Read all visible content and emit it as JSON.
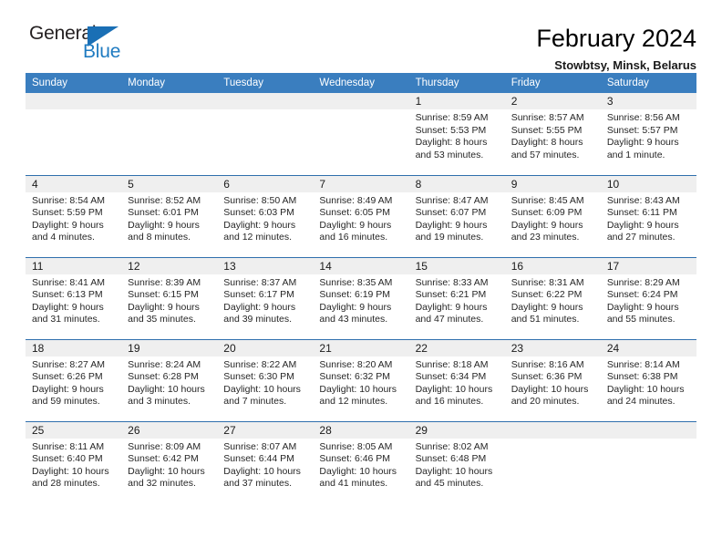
{
  "brand": {
    "name_top": "General",
    "name_bottom": "Blue",
    "accent_color": "#1a6fb5"
  },
  "header": {
    "title": "February 2024",
    "subtitle": "Stowbtsy, Minsk, Belarus"
  },
  "theme": {
    "header_row_bg": "#3a7ebf",
    "daynum_bg": "#efefef",
    "row_divider": "#2f6fad",
    "text": "#262626"
  },
  "labels": {
    "sunrise_prefix": "Sunrise:",
    "sunset_prefix": "Sunset:",
    "daylight_prefix": "Daylight:"
  },
  "weekdays": [
    "Sunday",
    "Monday",
    "Tuesday",
    "Wednesday",
    "Thursday",
    "Friday",
    "Saturday"
  ],
  "weeks": [
    [
      {
        "day": "",
        "empty": true
      },
      {
        "day": "",
        "empty": true
      },
      {
        "day": "",
        "empty": true
      },
      {
        "day": "",
        "empty": true
      },
      {
        "day": "1",
        "sunrise": "Sunrise: 8:59 AM",
        "sunset": "Sunset: 5:53 PM",
        "daylight_line1": "Daylight: 8 hours",
        "daylight_line2": "and 53 minutes."
      },
      {
        "day": "2",
        "sunrise": "Sunrise: 8:57 AM",
        "sunset": "Sunset: 5:55 PM",
        "daylight_line1": "Daylight: 8 hours",
        "daylight_line2": "and 57 minutes."
      },
      {
        "day": "3",
        "sunrise": "Sunrise: 8:56 AM",
        "sunset": "Sunset: 5:57 PM",
        "daylight_line1": "Daylight: 9 hours",
        "daylight_line2": "and 1 minute."
      }
    ],
    [
      {
        "day": "4",
        "sunrise": "Sunrise: 8:54 AM",
        "sunset": "Sunset: 5:59 PM",
        "daylight_line1": "Daylight: 9 hours",
        "daylight_line2": "and 4 minutes."
      },
      {
        "day": "5",
        "sunrise": "Sunrise: 8:52 AM",
        "sunset": "Sunset: 6:01 PM",
        "daylight_line1": "Daylight: 9 hours",
        "daylight_line2": "and 8 minutes."
      },
      {
        "day": "6",
        "sunrise": "Sunrise: 8:50 AM",
        "sunset": "Sunset: 6:03 PM",
        "daylight_line1": "Daylight: 9 hours",
        "daylight_line2": "and 12 minutes."
      },
      {
        "day": "7",
        "sunrise": "Sunrise: 8:49 AM",
        "sunset": "Sunset: 6:05 PM",
        "daylight_line1": "Daylight: 9 hours",
        "daylight_line2": "and 16 minutes."
      },
      {
        "day": "8",
        "sunrise": "Sunrise: 8:47 AM",
        "sunset": "Sunset: 6:07 PM",
        "daylight_line1": "Daylight: 9 hours",
        "daylight_line2": "and 19 minutes."
      },
      {
        "day": "9",
        "sunrise": "Sunrise: 8:45 AM",
        "sunset": "Sunset: 6:09 PM",
        "daylight_line1": "Daylight: 9 hours",
        "daylight_line2": "and 23 minutes."
      },
      {
        "day": "10",
        "sunrise": "Sunrise: 8:43 AM",
        "sunset": "Sunset: 6:11 PM",
        "daylight_line1": "Daylight: 9 hours",
        "daylight_line2": "and 27 minutes."
      }
    ],
    [
      {
        "day": "11",
        "sunrise": "Sunrise: 8:41 AM",
        "sunset": "Sunset: 6:13 PM",
        "daylight_line1": "Daylight: 9 hours",
        "daylight_line2": "and 31 minutes."
      },
      {
        "day": "12",
        "sunrise": "Sunrise: 8:39 AM",
        "sunset": "Sunset: 6:15 PM",
        "daylight_line1": "Daylight: 9 hours",
        "daylight_line2": "and 35 minutes."
      },
      {
        "day": "13",
        "sunrise": "Sunrise: 8:37 AM",
        "sunset": "Sunset: 6:17 PM",
        "daylight_line1": "Daylight: 9 hours",
        "daylight_line2": "and 39 minutes."
      },
      {
        "day": "14",
        "sunrise": "Sunrise: 8:35 AM",
        "sunset": "Sunset: 6:19 PM",
        "daylight_line1": "Daylight: 9 hours",
        "daylight_line2": "and 43 minutes."
      },
      {
        "day": "15",
        "sunrise": "Sunrise: 8:33 AM",
        "sunset": "Sunset: 6:21 PM",
        "daylight_line1": "Daylight: 9 hours",
        "daylight_line2": "and 47 minutes."
      },
      {
        "day": "16",
        "sunrise": "Sunrise: 8:31 AM",
        "sunset": "Sunset: 6:22 PM",
        "daylight_line1": "Daylight: 9 hours",
        "daylight_line2": "and 51 minutes."
      },
      {
        "day": "17",
        "sunrise": "Sunrise: 8:29 AM",
        "sunset": "Sunset: 6:24 PM",
        "daylight_line1": "Daylight: 9 hours",
        "daylight_line2": "and 55 minutes."
      }
    ],
    [
      {
        "day": "18",
        "sunrise": "Sunrise: 8:27 AM",
        "sunset": "Sunset: 6:26 PM",
        "daylight_line1": "Daylight: 9 hours",
        "daylight_line2": "and 59 minutes."
      },
      {
        "day": "19",
        "sunrise": "Sunrise: 8:24 AM",
        "sunset": "Sunset: 6:28 PM",
        "daylight_line1": "Daylight: 10 hours",
        "daylight_line2": "and 3 minutes."
      },
      {
        "day": "20",
        "sunrise": "Sunrise: 8:22 AM",
        "sunset": "Sunset: 6:30 PM",
        "daylight_line1": "Daylight: 10 hours",
        "daylight_line2": "and 7 minutes."
      },
      {
        "day": "21",
        "sunrise": "Sunrise: 8:20 AM",
        "sunset": "Sunset: 6:32 PM",
        "daylight_line1": "Daylight: 10 hours",
        "daylight_line2": "and 12 minutes."
      },
      {
        "day": "22",
        "sunrise": "Sunrise: 8:18 AM",
        "sunset": "Sunset: 6:34 PM",
        "daylight_line1": "Daylight: 10 hours",
        "daylight_line2": "and 16 minutes."
      },
      {
        "day": "23",
        "sunrise": "Sunrise: 8:16 AM",
        "sunset": "Sunset: 6:36 PM",
        "daylight_line1": "Daylight: 10 hours",
        "daylight_line2": "and 20 minutes."
      },
      {
        "day": "24",
        "sunrise": "Sunrise: 8:14 AM",
        "sunset": "Sunset: 6:38 PM",
        "daylight_line1": "Daylight: 10 hours",
        "daylight_line2": "and 24 minutes."
      }
    ],
    [
      {
        "day": "25",
        "sunrise": "Sunrise: 8:11 AM",
        "sunset": "Sunset: 6:40 PM",
        "daylight_line1": "Daylight: 10 hours",
        "daylight_line2": "and 28 minutes."
      },
      {
        "day": "26",
        "sunrise": "Sunrise: 8:09 AM",
        "sunset": "Sunset: 6:42 PM",
        "daylight_line1": "Daylight: 10 hours",
        "daylight_line2": "and 32 minutes."
      },
      {
        "day": "27",
        "sunrise": "Sunrise: 8:07 AM",
        "sunset": "Sunset: 6:44 PM",
        "daylight_line1": "Daylight: 10 hours",
        "daylight_line2": "and 37 minutes."
      },
      {
        "day": "28",
        "sunrise": "Sunrise: 8:05 AM",
        "sunset": "Sunset: 6:46 PM",
        "daylight_line1": "Daylight: 10 hours",
        "daylight_line2": "and 41 minutes."
      },
      {
        "day": "29",
        "sunrise": "Sunrise: 8:02 AM",
        "sunset": "Sunset: 6:48 PM",
        "daylight_line1": "Daylight: 10 hours",
        "daylight_line2": "and 45 minutes."
      },
      {
        "day": "",
        "empty": true
      },
      {
        "day": "",
        "empty": true
      }
    ]
  ]
}
